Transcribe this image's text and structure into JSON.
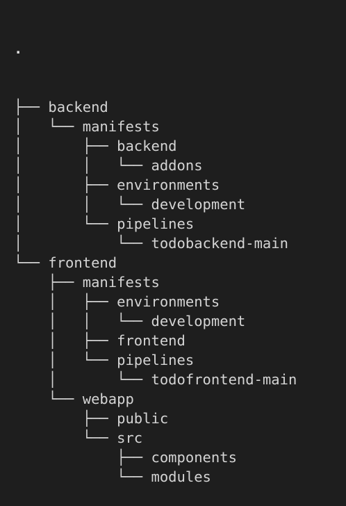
{
  "tree": {
    "root": ".",
    "rows": [
      {
        "prefix": "├── ",
        "name": "backend"
      },
      {
        "prefix": "│   └── ",
        "name": "manifests"
      },
      {
        "prefix": "│       ├── ",
        "name": "backend"
      },
      {
        "prefix": "│       │   └── ",
        "name": "addons"
      },
      {
        "prefix": "│       ├── ",
        "name": "environments"
      },
      {
        "prefix": "│       │   └── ",
        "name": "development"
      },
      {
        "prefix": "│       └── ",
        "name": "pipelines"
      },
      {
        "prefix": "│           └── ",
        "name": "todobackend-main"
      },
      {
        "prefix": "└── ",
        "name": "frontend"
      },
      {
        "prefix": "    ├── ",
        "name": "manifests"
      },
      {
        "prefix": "    │   ├── ",
        "name": "environments"
      },
      {
        "prefix": "    │   │   └── ",
        "name": "development"
      },
      {
        "prefix": "    │   ├── ",
        "name": "frontend"
      },
      {
        "prefix": "    │   └── ",
        "name": "pipelines"
      },
      {
        "prefix": "    │       └── ",
        "name": "todofrontend-main"
      },
      {
        "prefix": "    └── ",
        "name": "webapp"
      },
      {
        "prefix": "        ├── ",
        "name": "public"
      },
      {
        "prefix": "        └── ",
        "name": "src"
      },
      {
        "prefix": "            ├── ",
        "name": "components"
      },
      {
        "prefix": "            └── ",
        "name": "modules"
      }
    ]
  },
  "colors": {
    "background": "#1e1e1e",
    "text": "#d4d4d4"
  }
}
